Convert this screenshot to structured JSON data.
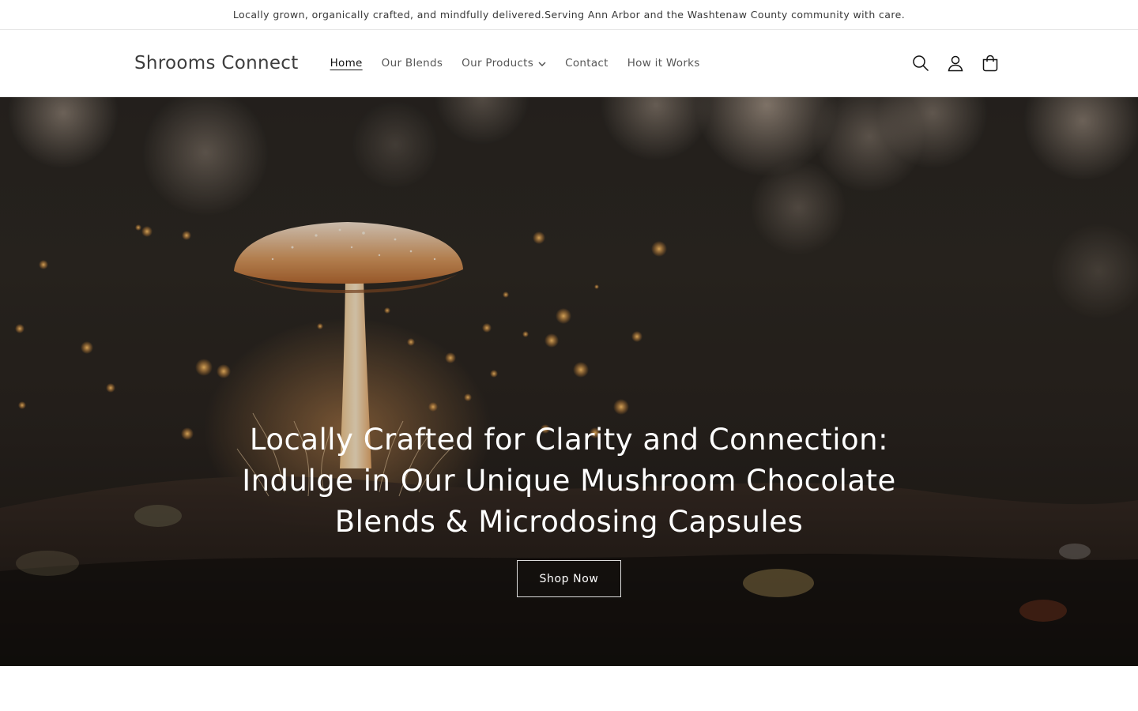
{
  "announcement": {
    "text": "Locally grown, organically crafted, and mindfully delivered.Serving Ann Arbor and the Washtenaw County community with care."
  },
  "header": {
    "logo": "Shrooms Connect",
    "nav": [
      {
        "label": "Home",
        "active": true
      },
      {
        "label": "Our Blends",
        "active": false
      },
      {
        "label": "Our Products",
        "active": false,
        "dropdown": true
      },
      {
        "label": "Contact",
        "active": false
      },
      {
        "label": "How it Works",
        "active": false
      }
    ],
    "icons": [
      "search-icon",
      "account-icon",
      "cart-icon"
    ]
  },
  "hero": {
    "title": "Locally Crafted for Clarity and Connection: Indulge in Our Unique Mushroom Chocolate Blends & Microdosing Capsules",
    "button": "Shop Now",
    "image": "glowing-mushroom-forest-floor"
  },
  "colors": {
    "text": "#121212",
    "hero_text": "#ffffff",
    "border": "#e6e6e6"
  }
}
